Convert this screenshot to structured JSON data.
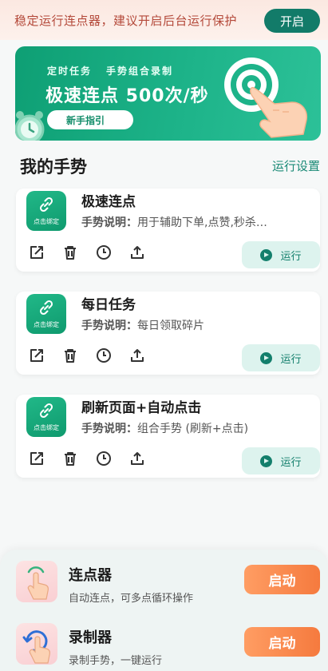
{
  "notice": {
    "text": "稳定运行连点器，建议开启后台运行保护",
    "button_label": "开启"
  },
  "banner": {
    "subtitle_left": "定时任务",
    "subtitle_right": "手势组合录制",
    "title": "极速连点 500次/秒",
    "guide_button": "新手指引"
  },
  "gestures": {
    "section_title": "我的手势",
    "settings_link": "运行设置",
    "icon_label": "点击绑定",
    "desc_prefix": "手势说明：",
    "run_label": "运行",
    "items": [
      {
        "title": "极速连点",
        "desc": "用于辅助下单,点赞,秒杀…"
      },
      {
        "title": "每日任务",
        "desc": "每日领取碎片"
      },
      {
        "title": "刷新页面+自动点击",
        "desc": "组合手势 (刷新+点击)"
      }
    ],
    "tool_icons": [
      "edit-icon",
      "trash-icon",
      "clock-icon",
      "share-icon"
    ]
  },
  "tools_panel": {
    "items": [
      {
        "title": "连点器",
        "desc": "自动连点，可多点循环操作",
        "button": "启动"
      },
      {
        "title": "录制器",
        "desc": "录制手势，一键运行",
        "button": "启动"
      }
    ]
  },
  "colors": {
    "accent_green": "#127b69",
    "banner_green": "#1db389",
    "notice_text": "#b4493a",
    "start_orange": "#f57a3e",
    "run_bg": "#ddf3ee"
  }
}
